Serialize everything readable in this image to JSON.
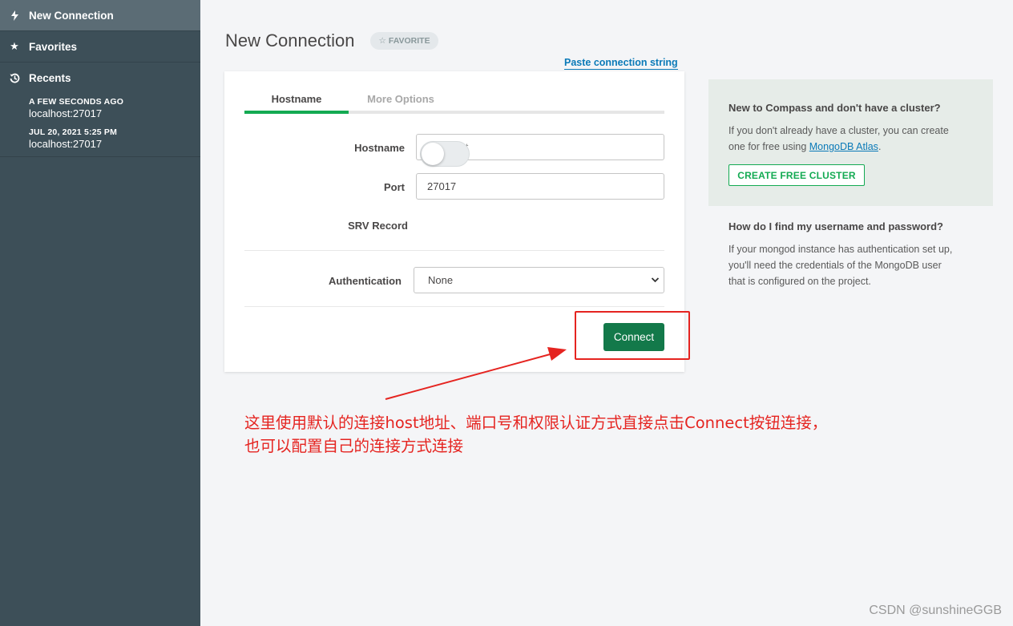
{
  "sidebar": {
    "new_connection": "New Connection",
    "favorites": "Favorites",
    "recents": "Recents",
    "recent_items": [
      {
        "when": "A FEW SECONDS AGO",
        "host": "localhost:27017"
      },
      {
        "when": "JUL 20, 2021 5:25 PM",
        "host": "localhost:27017"
      }
    ]
  },
  "main": {
    "title": "New Connection",
    "favorite_badge": "FAVORITE",
    "paste_link": "Paste connection string",
    "tabs": [
      "Hostname",
      "More Options"
    ],
    "hostname_label": "Hostname",
    "hostname_placeholder": "localhost",
    "port_label": "Port",
    "port_value": "27017",
    "srv_label": "SRV Record",
    "srv_enabled": false,
    "auth_label": "Authentication",
    "auth_value": "None",
    "connect_label": "Connect"
  },
  "info": {
    "cluster_heading": "New to Compass and don't have a cluster?",
    "cluster_text_1": "If you don't already have a cluster, you can create",
    "cluster_text_2a": "one for free using ",
    "atlas_link": "MongoDB Atlas",
    "cluster_text_2b": ".",
    "create_cluster": "CREATE FREE CLUSTER",
    "creds_heading": "How do I find my username and password?",
    "creds_text_1": "If your mongod instance has authentication set up,",
    "creds_text_2": "you'll need the credentials of the MongoDB user",
    "creds_text_3": "that is configured on the project."
  },
  "annotation": {
    "line1": "这里使用默认的连接host地址、端口号和权限认证方式直接点击Connect按钮连接，",
    "line2": "也可以配置自己的连接方式连接"
  },
  "watermark": "CSDN @sunshineGGB",
  "colors": {
    "sidebar": "#3d4f58",
    "accent_green": "#13aa52",
    "connect_green": "#13794a",
    "annotation_red": "#e52420",
    "link_blue": "#0b7ab8"
  }
}
